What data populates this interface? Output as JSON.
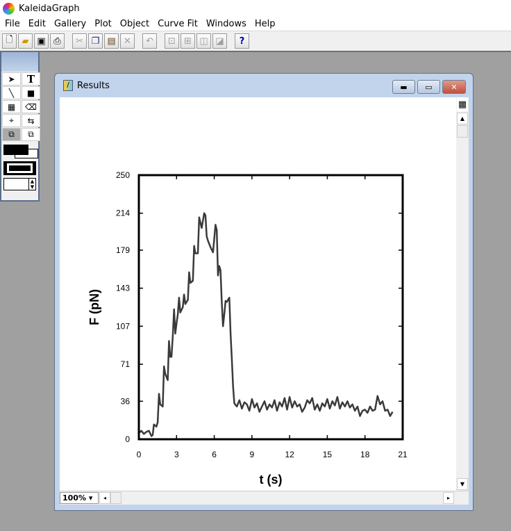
{
  "app": {
    "title": "KaleidaGraph"
  },
  "menu": [
    "File",
    "Edit",
    "Gallery",
    "Plot",
    "Object",
    "Curve Fit",
    "Windows",
    "Help"
  ],
  "toolbar": {
    "icons": [
      "new-icon",
      "open-icon",
      "save-icon",
      "print-icon",
      "cut-icon",
      "copy-icon",
      "paste-icon",
      "clear-icon",
      "undo-icon",
      "align-icon",
      "group-icon",
      "bring-front-icon",
      "send-back-icon",
      "help-icon"
    ],
    "help_label": "?"
  },
  "palette": {
    "text_tool": "T"
  },
  "window": {
    "title": "Results",
    "zoom": "100%"
  },
  "chart_data": {
    "type": "line",
    "xlabel": "t (s)",
    "ylabel": "F (pN)",
    "xlim": [
      0,
      21
    ],
    "ylim": [
      0,
      250
    ],
    "xticks": [
      "0",
      "3",
      "6",
      "9",
      "12",
      "15",
      "18",
      "21"
    ],
    "yticks": [
      "0",
      "36",
      "71",
      "107",
      "143",
      "179",
      "214",
      "250"
    ],
    "grid": false,
    "x": [
      0,
      0.2,
      0.4,
      0.6,
      0.8,
      1.0,
      1.1,
      1.2,
      1.4,
      1.5,
      1.6,
      1.7,
      1.9,
      2.0,
      2.1,
      2.3,
      2.4,
      2.5,
      2.6,
      2.7,
      2.8,
      2.9,
      3.0,
      3.1,
      3.2,
      3.3,
      3.5,
      3.6,
      3.7,
      3.9,
      4.0,
      4.1,
      4.3,
      4.4,
      4.5,
      4.7,
      4.8,
      4.9,
      5.0,
      5.1,
      5.2,
      5.3,
      5.4,
      5.5,
      5.7,
      5.9,
      6.0,
      6.1,
      6.2,
      6.3,
      6.4,
      6.5,
      6.6,
      6.7,
      6.8,
      6.9,
      7.0,
      7.2,
      7.3,
      7.4,
      7.5,
      7.6,
      7.8,
      8.0,
      8.2,
      8.4,
      8.6,
      8.8,
      9.0,
      9.2,
      9.4,
      9.6,
      9.8,
      10.0,
      10.2,
      10.4,
      10.6,
      10.8,
      11.0,
      11.2,
      11.4,
      11.6,
      11.8,
      12.0,
      12.2,
      12.4,
      12.6,
      12.8,
      13.0,
      13.2,
      13.4,
      13.6,
      13.8,
      14.0,
      14.2,
      14.4,
      14.6,
      14.8,
      15.0,
      15.2,
      15.4,
      15.6,
      15.8,
      16.0,
      16.2,
      16.4,
      16.6,
      16.8,
      17.0,
      17.2,
      17.4,
      17.6,
      17.8,
      18.0,
      18.2,
      18.4,
      18.6,
      18.8,
      19.0,
      19.2,
      19.4,
      19.6,
      19.8,
      20.0,
      20.2
    ],
    "y": [
      6,
      8,
      5,
      7,
      8,
      3,
      4,
      14,
      12,
      16,
      43,
      33,
      31,
      69,
      62,
      56,
      93,
      78,
      78,
      98,
      123,
      100,
      110,
      118,
      134,
      120,
      125,
      137,
      128,
      132,
      158,
      148,
      150,
      183,
      176,
      176,
      210,
      205,
      200,
      207,
      214,
      212,
      192,
      188,
      182,
      177,
      190,
      203,
      198,
      155,
      164,
      160,
      130,
      107,
      118,
      131,
      130,
      134,
      100,
      76,
      50,
      34,
      31,
      37,
      29,
      35,
      33,
      27,
      38,
      30,
      34,
      26,
      31,
      36,
      28,
      33,
      30,
      37,
      27,
      35,
      31,
      39,
      28,
      40,
      30,
      36,
      31,
      33,
      26,
      30,
      37,
      34,
      39,
      28,
      33,
      27,
      34,
      31,
      38,
      29,
      36,
      32,
      40,
      29,
      35,
      31,
      36,
      30,
      33,
      27,
      31,
      22,
      27,
      28,
      25,
      31,
      27,
      28,
      41,
      33,
      36,
      27,
      28,
      22,
      26
    ],
    "line_color": "#3a3a3a"
  }
}
